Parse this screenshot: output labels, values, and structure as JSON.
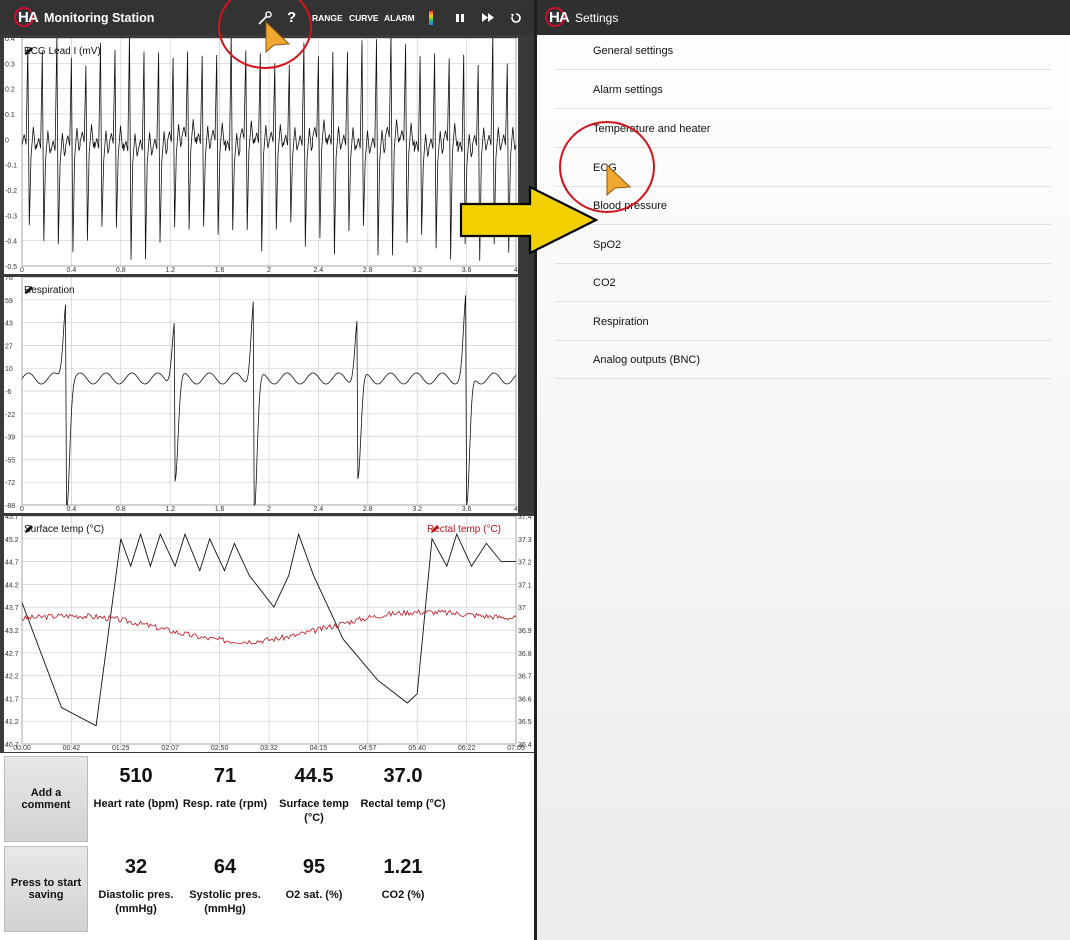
{
  "left_app": {
    "title": "Monitoring Station",
    "toolbar": {
      "range_label": "RANGE",
      "curve_label": "CURVE",
      "alarm_label": "ALARM",
      "help_label": "?"
    }
  },
  "charts": {
    "ecg": {
      "label": "ECG Lead I (mV)",
      "y_ticks": [
        "0.4",
        "0.3",
        "0.2",
        "0.1",
        "0",
        "-0.1",
        "-0.2",
        "-0.3",
        "-0.4",
        "-0.5"
      ],
      "x_ticks": [
        "0",
        "0.4",
        "0.8",
        "1.2",
        "1.6",
        "2",
        "2.4",
        "2.8",
        "3.2",
        "3.6",
        "4"
      ]
    },
    "respiration": {
      "label": "Respiration",
      "y_ticks": [
        "76",
        "59",
        "43",
        "27",
        "10",
        "-6",
        "-22",
        "-39",
        "-55",
        "-72",
        "-88"
      ],
      "x_ticks": [
        "0",
        "0.4",
        "0.8",
        "1.2",
        "1.6",
        "2",
        "2.4",
        "2.8",
        "3.2",
        "3.6",
        "4"
      ]
    },
    "temperature": {
      "label_left": "Surface temp (°C)",
      "label_right": "Rectal temp (°C)",
      "y_ticks_left": [
        "45.7",
        "45.2",
        "44.7",
        "44.2",
        "43.7",
        "43.2",
        "42.7",
        "42.2",
        "41.7",
        "41.2",
        "40.7"
      ],
      "y_ticks_right": [
        "37.4",
        "37.3",
        "37.2",
        "37.1",
        "37",
        "36.9",
        "36.8",
        "36.7",
        "36.6",
        "36.5",
        "36.4"
      ],
      "x_ticks": [
        "00:00",
        "00:42",
        "01:25",
        "02:07",
        "02:50",
        "03:32",
        "04:15",
        "04:57",
        "05:40",
        "06:22",
        "07:05"
      ],
      "rectal_color": "#c0141c"
    }
  },
  "buttons": {
    "comment": "Add a comment",
    "save": "Press to start saving"
  },
  "stats_row1": [
    {
      "value": "510",
      "label": "Heart rate (bpm)"
    },
    {
      "value": "71",
      "label": "Resp. rate (rpm)"
    },
    {
      "value": "44.5",
      "label": "Surface temp (°C)"
    },
    {
      "value": "37.0",
      "label": "Rectal temp (°C)"
    }
  ],
  "stats_row2": [
    {
      "value": "32",
      "label": "Diastolic pres. (mmHg)"
    },
    {
      "value": "64",
      "label": "Systolic pres. (mmHg)"
    },
    {
      "value": "95",
      "label": "O2 sat. (%)"
    },
    {
      "value": "1.21",
      "label": "CO2 (%)"
    }
  ],
  "settings": {
    "title": "Settings",
    "items": [
      "General settings",
      "Alarm settings",
      "Temperature and heater",
      "ECG",
      "Blood pressure",
      "SpO2",
      "CO2",
      "Respiration",
      "Analog outputs (BNC)"
    ]
  },
  "colors": {
    "accent_red": "#c8102e",
    "arrow_yellow": "#f5d000",
    "cursor_orange": "#f0a830"
  }
}
